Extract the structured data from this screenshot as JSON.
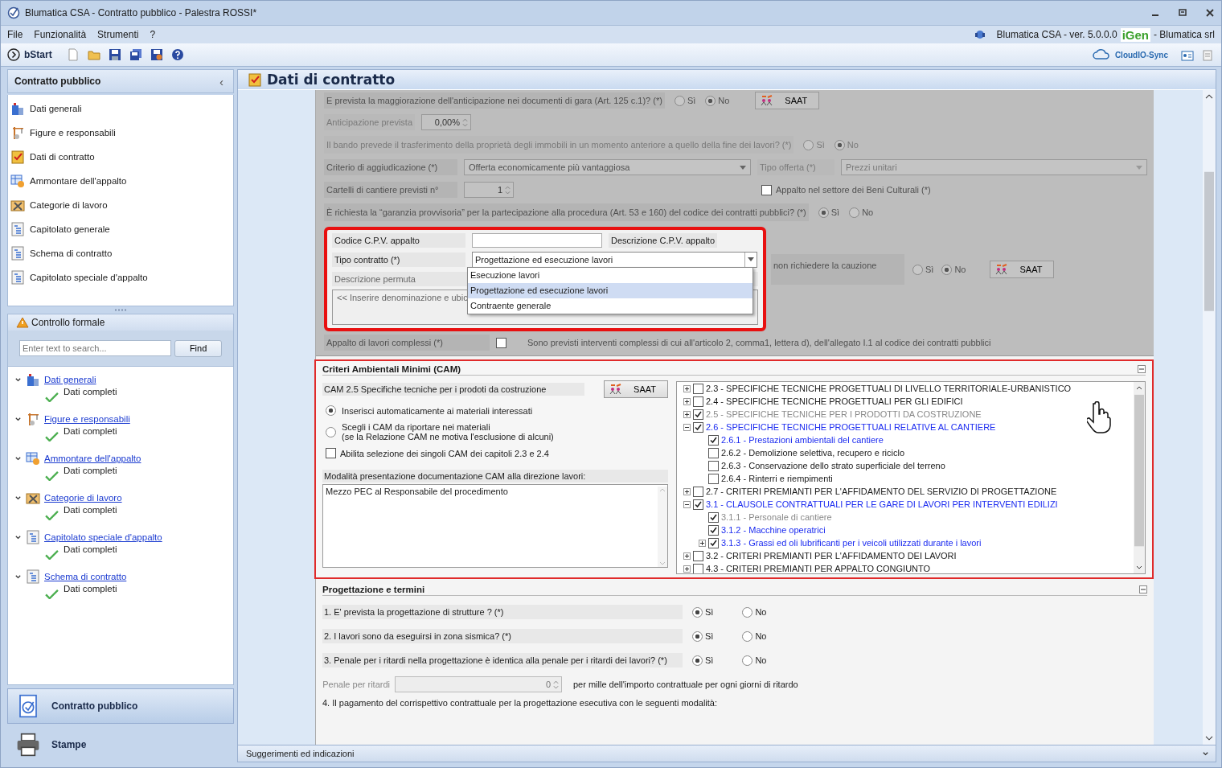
{
  "window": {
    "title": "Blumatica CSA - Contratto pubblico - Palestra ROSSI*"
  },
  "menu": [
    "File",
    "Funzionalità",
    "Strumenti",
    "?"
  ],
  "app_info": {
    "product": "Blumatica CSA - ver. 5.0.0.0",
    "badge": "iGen",
    "company": "- Blumatica srl"
  },
  "toolbar": {
    "start": "bStart",
    "sync": "CloudIO-Sync"
  },
  "sidebar": {
    "title": "Contratto pubblico",
    "collapse": "‹",
    "items": [
      {
        "label": "Dati generali",
        "kind": "building"
      },
      {
        "label": "Figure e responsabili",
        "kind": "crane"
      },
      {
        "label": "Dati di contratto",
        "kind": "clipboard"
      },
      {
        "label": "Ammontare dell'appalto",
        "kind": "table"
      },
      {
        "label": "Categorie di lavoro",
        "kind": "tools"
      },
      {
        "label": "Capitolato generale",
        "kind": "outline"
      },
      {
        "label": "Schema di contratto",
        "kind": "outline"
      },
      {
        "label": "Capitolato speciale d'appalto",
        "kind": "outline"
      }
    ]
  },
  "check_panel": {
    "title": "Controllo formale",
    "search_placeholder": "Enter text to search...",
    "find": "Find",
    "groups": [
      {
        "label": "Dati generali",
        "kind": "building",
        "expanded": true,
        "children": [
          {
            "label": "Dati completi"
          }
        ]
      },
      {
        "label": "Figure e responsabili",
        "kind": "crane",
        "expanded": true,
        "children": [
          {
            "label": "Dati completi"
          }
        ]
      },
      {
        "label": "Ammontare dell'appalto",
        "kind": "table",
        "expanded": true,
        "children": [
          {
            "label": "Dati completi"
          }
        ]
      },
      {
        "label": "Categorie di lavoro",
        "kind": "tools",
        "expanded": true,
        "children": [
          {
            "label": "Dati completi"
          }
        ]
      },
      {
        "label": "Capitolato speciale d'appalto",
        "kind": "outline",
        "expanded": true,
        "children": [
          {
            "label": "Dati completi"
          }
        ]
      },
      {
        "label": "Schema di contratto",
        "kind": "outline",
        "expanded": true,
        "children": [
          {
            "label": "Dati completi"
          }
        ]
      }
    ]
  },
  "nav_buttons": [
    {
      "label": "Contratto pubblico",
      "kind": "contract",
      "selected": true
    },
    {
      "label": "Stampe",
      "kind": "printer",
      "selected": false
    }
  ],
  "page": {
    "title": "Dati di contratto"
  },
  "contract_form": {
    "anticipation_question": {
      "label": "E prevista la maggiorazione dell'anticipazione nei documenti di gara (Art. 125 c.1)? (*)",
      "options": [
        {
          "label": "Sì",
          "selected": false
        },
        {
          "label": "No",
          "selected": true
        }
      ],
      "saat": "SAAT"
    },
    "anticipation": {
      "label": "Anticipazione prevista",
      "value": "0,00%",
      "disabled": true
    },
    "transfer_question": {
      "label": "Il bando prevede il trasferimento della proprietà degli immobili in un momento anteriore a quello della fine dei lavori? (*)",
      "disabled": true,
      "options": [
        {
          "label": "Sì",
          "selected": false
        },
        {
          "label": "No",
          "selected": true
        }
      ]
    },
    "award": {
      "label": "Criterio di aggiudicazione (*)",
      "value": "Offerta economicamente più vantaggiosa"
    },
    "offer_type": {
      "label": "Tipo offerta (*)",
      "value": "Prezzi unitari",
      "disabled": true
    },
    "site_signs": {
      "label": "Cartelli di cantiere previsti n°",
      "value": "1"
    },
    "cultural_heritage": {
      "label": "Appalto nel settore dei Beni Culturali (*)",
      "checked": false
    },
    "guarantee_question": {
      "label": "È richiesta la “garanzia provvisoria” per la partecipazione alla procedura (Art. 53 e 160) del codice dei contratti pubblici? (*)",
      "options": [
        {
          "label": "Sì",
          "selected": true
        },
        {
          "label": "No",
          "selected": false
        }
      ]
    },
    "cpv_code": {
      "label": "Codice C.P.V. appalto"
    },
    "cpv_description": {
      "label": "Descrizione C.P.V. appalto"
    },
    "contract_type": {
      "label": "Tipo contratto (*)",
      "value": "Progettazione ed esecuzione lavori",
      "expanded": true,
      "options": [
        {
          "label": "Esecuzione lavori",
          "selected": false
        },
        {
          "label": "Progettazione ed esecuzione lavori",
          "selected": true
        },
        {
          "label": "Contraente generale",
          "selected": false
        }
      ]
    },
    "exchange_description": {
      "label": "Descrizione permuta",
      "placeholder": "<< Inserire denominazione e ubic"
    },
    "deposit_question": {
      "label": "non richiedere la cauzione",
      "options": [
        {
          "label": "Sì",
          "selected": false
        },
        {
          "label": "No",
          "selected": true
        }
      ],
      "saat": "SAAT"
    },
    "complex_works": {
      "label": "Appalto di lavori complessi (*)",
      "checked": false,
      "note": "Sono previsti interventi complessi di cui all'articolo 2, comma1, lettera d), dell'allegato I.1 al codice dei contratti pubblici"
    }
  },
  "cam": {
    "title": "Criteri Ambientali Minimi (CAM)",
    "subtitle": "CAM 2.5 Specifiche tecniche per i prodoti da costruzione",
    "saat": "SAAT",
    "options": [
      {
        "label": "Inserisci automaticamente ai materiali interessati",
        "selected": true
      },
      {
        "label": "Scegli i CAM da riportare nei materiali",
        "note": "(se la Relazione CAM ne motiva l'esclusione di alcuni)",
        "selected": false
      }
    ],
    "chapter_select": {
      "label": "Abilita selezione dei singoli CAM dei capitoli 2.3 e 2.4",
      "checked": false
    },
    "submission_label": "Modalità presentazione documentazione CAM alla direzione lavori:",
    "submission_value": "Mezzo PEC al Responsabile del procedimento",
    "tree": [
      {
        "label": "2.3 - SPECIFICHE TECNICHE PROGETTUALI DI LIVELLO TERRITORIALE-URBANISTICO",
        "checked": false,
        "expanded": false,
        "highlighted": false,
        "disabled": false
      },
      {
        "label": "2.4 - SPECIFICHE TECNICHE PROGETTUALI PER GLI EDIFICI",
        "checked": false,
        "expanded": false,
        "highlighted": false,
        "disabled": false
      },
      {
        "label": "2.5 - SPECIFICHE TECNICHE PER I PRODOTTI DA COSTRUZIONE",
        "checked": true,
        "expanded": false,
        "highlighted": false,
        "disabled": true
      },
      {
        "label": "2.6 - SPECIFICHE TECNICHE PROGETTUALI RELATIVE AL CANTIERE",
        "checked": true,
        "expanded": true,
        "highlighted": true,
        "disabled": false,
        "children": [
          {
            "label": "2.6.1 - Prestazioni ambientali del cantiere",
            "checked": true,
            "highlighted": true,
            "disabled": false
          },
          {
            "label": "2.6.2 - Demolizione selettiva, recupero e riciclo",
            "checked": false,
            "highlighted": false,
            "disabled": false
          },
          {
            "label": "2.6.3 - Conservazione dello strato superficiale del terreno",
            "checked": false,
            "highlighted": false,
            "disabled": false
          },
          {
            "label": "2.6.4 - Rinterri e riempimenti",
            "checked": false,
            "highlighted": false,
            "disabled": false
          }
        ]
      },
      {
        "label": "2.7 - CRITERI PREMIANTI PER L'AFFIDAMENTO DEL SERVIZIO DI PROGETTAZIONE",
        "checked": false,
        "expanded": false,
        "highlighted": false,
        "disabled": false
      },
      {
        "label": "3.1 - CLAUSOLE CONTRATTUALI PER LE GARE DI LAVORI PER INTERVENTI EDILIZI",
        "checked": true,
        "expanded": true,
        "highlighted": true,
        "disabled": false,
        "children": [
          {
            "label": "3.1.1 - Personale di  cantiere",
            "checked": true,
            "highlighted": false,
            "disabled": true
          },
          {
            "label": "3.1.2 - Macchine operatrici",
            "checked": true,
            "highlighted": true,
            "disabled": false
          },
          {
            "label": "3.1.3 - Grassi ed oli lubrificanti per i veicoli utilizzati durante i lavori",
            "checked": true,
            "expanded": false,
            "highlighted": true,
            "disabled": false
          }
        ]
      },
      {
        "label": "3.2 - CRITERI PREMIANTI PER L'AFFIDAMENTO DEI LAVORI",
        "checked": false,
        "expanded": false,
        "highlighted": false,
        "disabled": false
      },
      {
        "label": "4.3 - CRITERI PREMIANTI PER APPALTO CONGIUNTO",
        "checked": false,
        "expanded": false,
        "highlighted": false,
        "disabled": false
      }
    ]
  },
  "design": {
    "title": "Progettazione e termini",
    "questions": [
      {
        "label": "1. E' prevista la progettazione di strutture ?  (*)",
        "options": [
          {
            "label": "Sì",
            "selected": true
          },
          {
            "label": "No",
            "selected": false
          }
        ]
      },
      {
        "label": "2. I lavori sono da eseguirsi in zona sismica? (*)",
        "options": [
          {
            "label": "Sì",
            "selected": true
          },
          {
            "label": "No",
            "selected": false
          }
        ]
      },
      {
        "label": "3. Penale per i ritardi nella progettazione è identica alla penale per i ritardi dei lavori? (*)",
        "options": [
          {
            "label": "Sì",
            "selected": true
          },
          {
            "label": "No",
            "selected": false
          }
        ]
      }
    ],
    "penalty": {
      "label": "Penale per ritardi",
      "value": "0",
      "disabled": true,
      "unit": "per mille dell'importo contrattuale per ogni giorni di ritardo"
    },
    "payment_label": "4. Il pagamento del corrispettivo contrattuale per la progettazione esecutiva con le seguenti modalità:"
  },
  "status_bar": "Suggerimenti ed indicazioni"
}
